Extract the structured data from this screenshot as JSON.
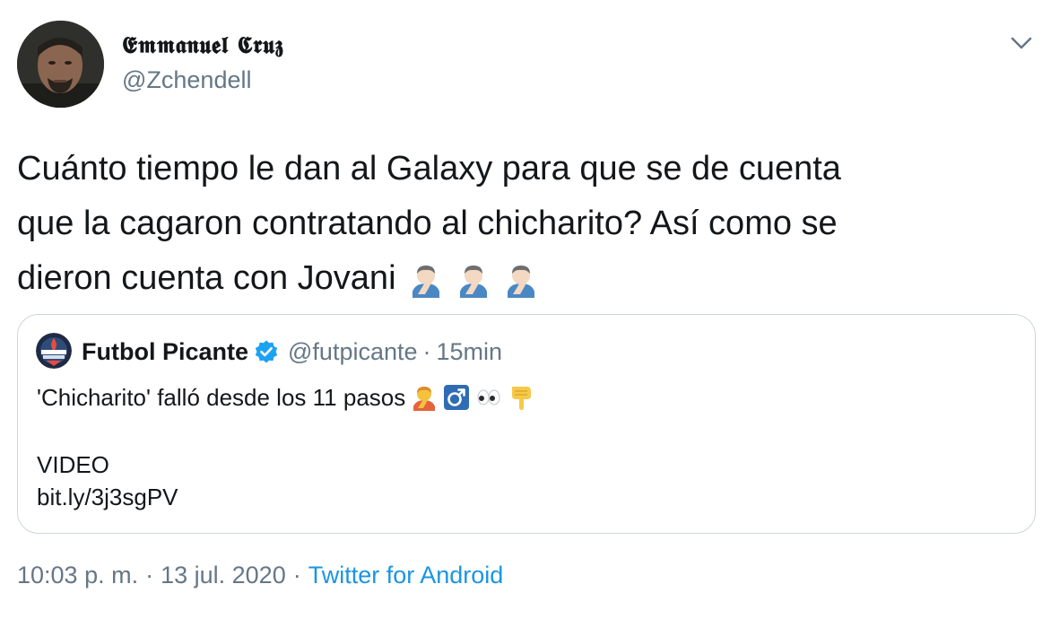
{
  "author": {
    "name": "𝕰𝖒𝖒𝖆𝖓𝖚𝖊𝖑 𝕮𝖗𝖚𝖟",
    "handle": "@Zchendell"
  },
  "tweet": {
    "lines": [
      "Cuánto tiempo le dan al Galaxy para que se de cuenta",
      "que la cagaron contratando al chicharito? Así como se",
      "dieron cuenta con Jovani"
    ],
    "emojis": [
      "man-facepalming",
      "man-facepalming",
      "man-facepalming"
    ]
  },
  "quote": {
    "name": "Futbol Picante",
    "verified": true,
    "handle": "@futpicante",
    "separator": "·",
    "time": "15min",
    "text": "'Chicharito' falló desde los 11 pasos",
    "emojis": [
      "person-facepalming",
      "male-sign",
      "eyes",
      "backhand-index-pointing-down"
    ],
    "video_label": "VIDEO",
    "link": "bit.ly/3j3sgPV",
    "avatar_lettering": "FUTBOL PICANTE"
  },
  "meta": {
    "time": "10:03 p. m.",
    "separator": "·",
    "date": "13 jul. 2020",
    "source": "Twitter for Android"
  },
  "colors": {
    "text": "#14171a",
    "secondary": "#657786",
    "link": "#1b95e0",
    "border": "#ccd6dd",
    "verified": "#1da1f2"
  }
}
